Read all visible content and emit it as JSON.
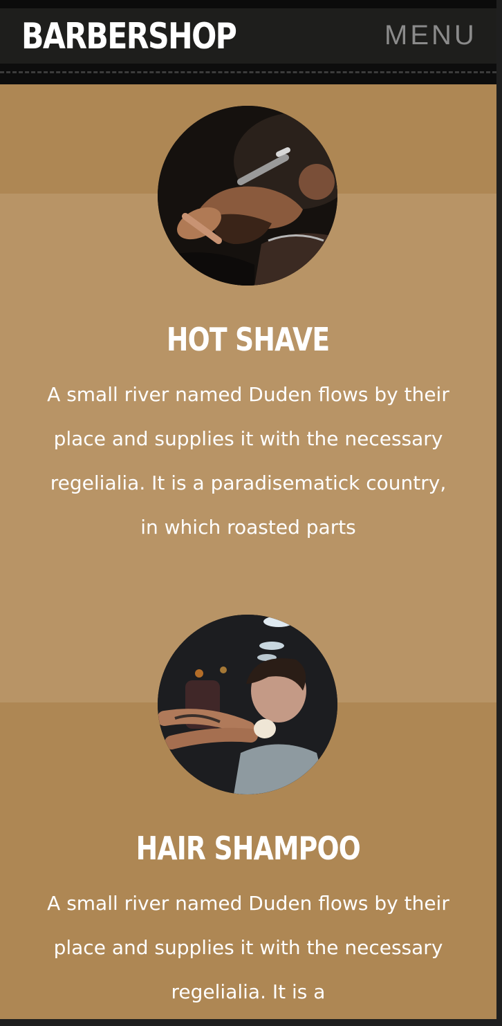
{
  "header": {
    "brand": "BARBERSHOP",
    "menu_label": "MENU"
  },
  "services": [
    {
      "title": "HOT SHAVE",
      "description": "A small river named Duden flows by their place and supplies it with the necessary regelialia. It is a paradisematick country, in which roasted parts",
      "photo_icon": "barber-shaving-photo"
    },
    {
      "title": "HAIR SHAMPOO",
      "description": "A small river named Duden flows by their place and supplies it with the necessary regelialia. It is a",
      "photo_icon": "hair-shampoo-photo"
    }
  ],
  "colors": {
    "navbar": "#1e1e1c",
    "tan_dark": "#ae8754",
    "tan_light": "#b89466",
    "text": "#ffffff",
    "menu_text": "#8b8b8b"
  }
}
